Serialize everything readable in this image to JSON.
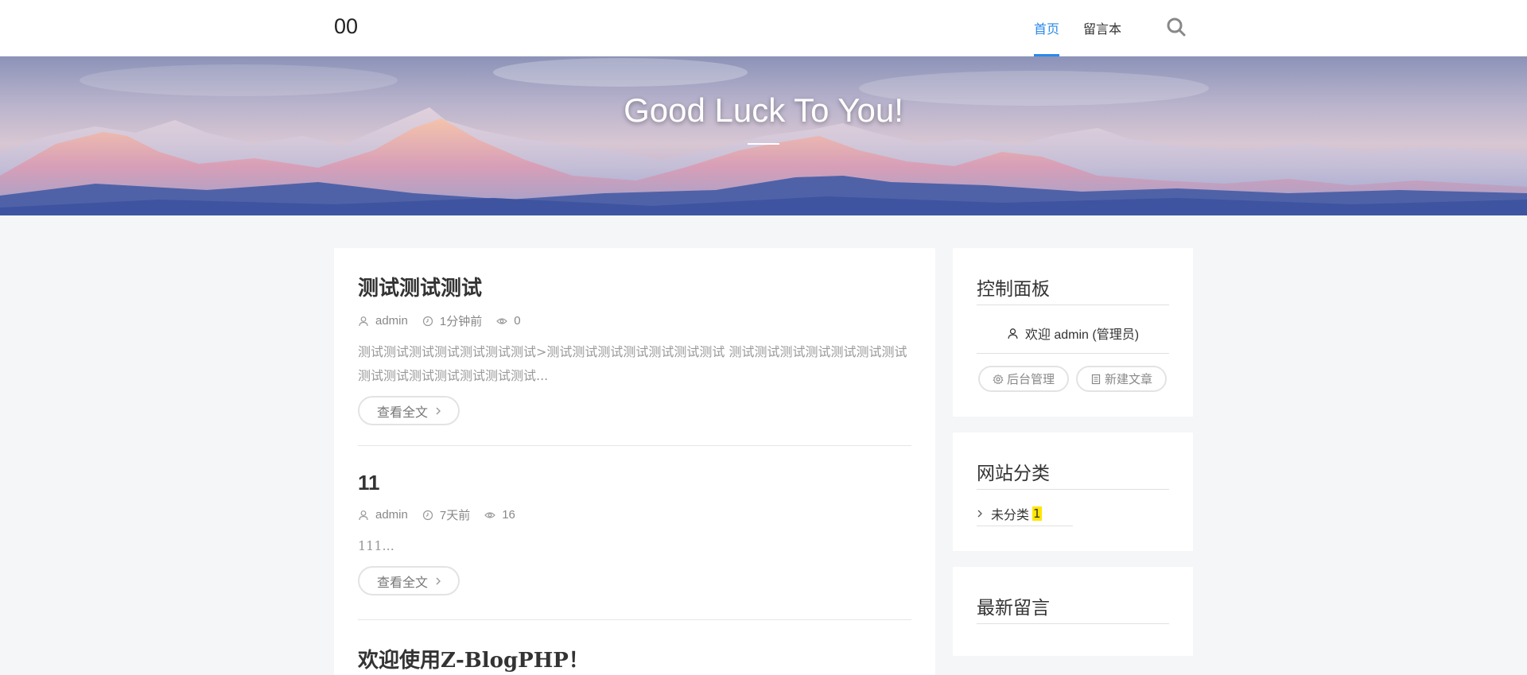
{
  "header": {
    "logo": "00",
    "nav": [
      {
        "label": "首页",
        "active": true
      },
      {
        "label": "留言本",
        "active": false
      }
    ],
    "search_icon": "search-icon",
    "accent_color": "#2a89ea"
  },
  "banner": {
    "title": "Good Luck To You!"
  },
  "posts": [
    {
      "title": "测试测试测试",
      "author": "admin",
      "time": "1分钟前",
      "views": "0",
      "excerpt_line1": "测试测试测试测试测试测试测试>测试测试测试测试测试测试测试 测试测试测试测试测试测试测试",
      "excerpt_line2": "测试测试测试测试测试测试测试...",
      "read_more": "查看全文"
    },
    {
      "title": "11",
      "author": "admin",
      "time": "7天前",
      "views": "16",
      "excerpt_line1": "111...",
      "read_more": "查看全文"
    },
    {
      "title": "欢迎使用Z-BlogPHP！"
    }
  ],
  "sidebar": {
    "control_panel": {
      "title": "控制面板",
      "welcome": "欢迎 admin (管理员)",
      "admin_button": "后台管理",
      "new_post_button": "新建文章"
    },
    "categories": {
      "title": "网站分类",
      "items": [
        {
          "label": "未分类",
          "count": "1"
        }
      ]
    },
    "latest_comments": {
      "title": "最新留言"
    }
  }
}
